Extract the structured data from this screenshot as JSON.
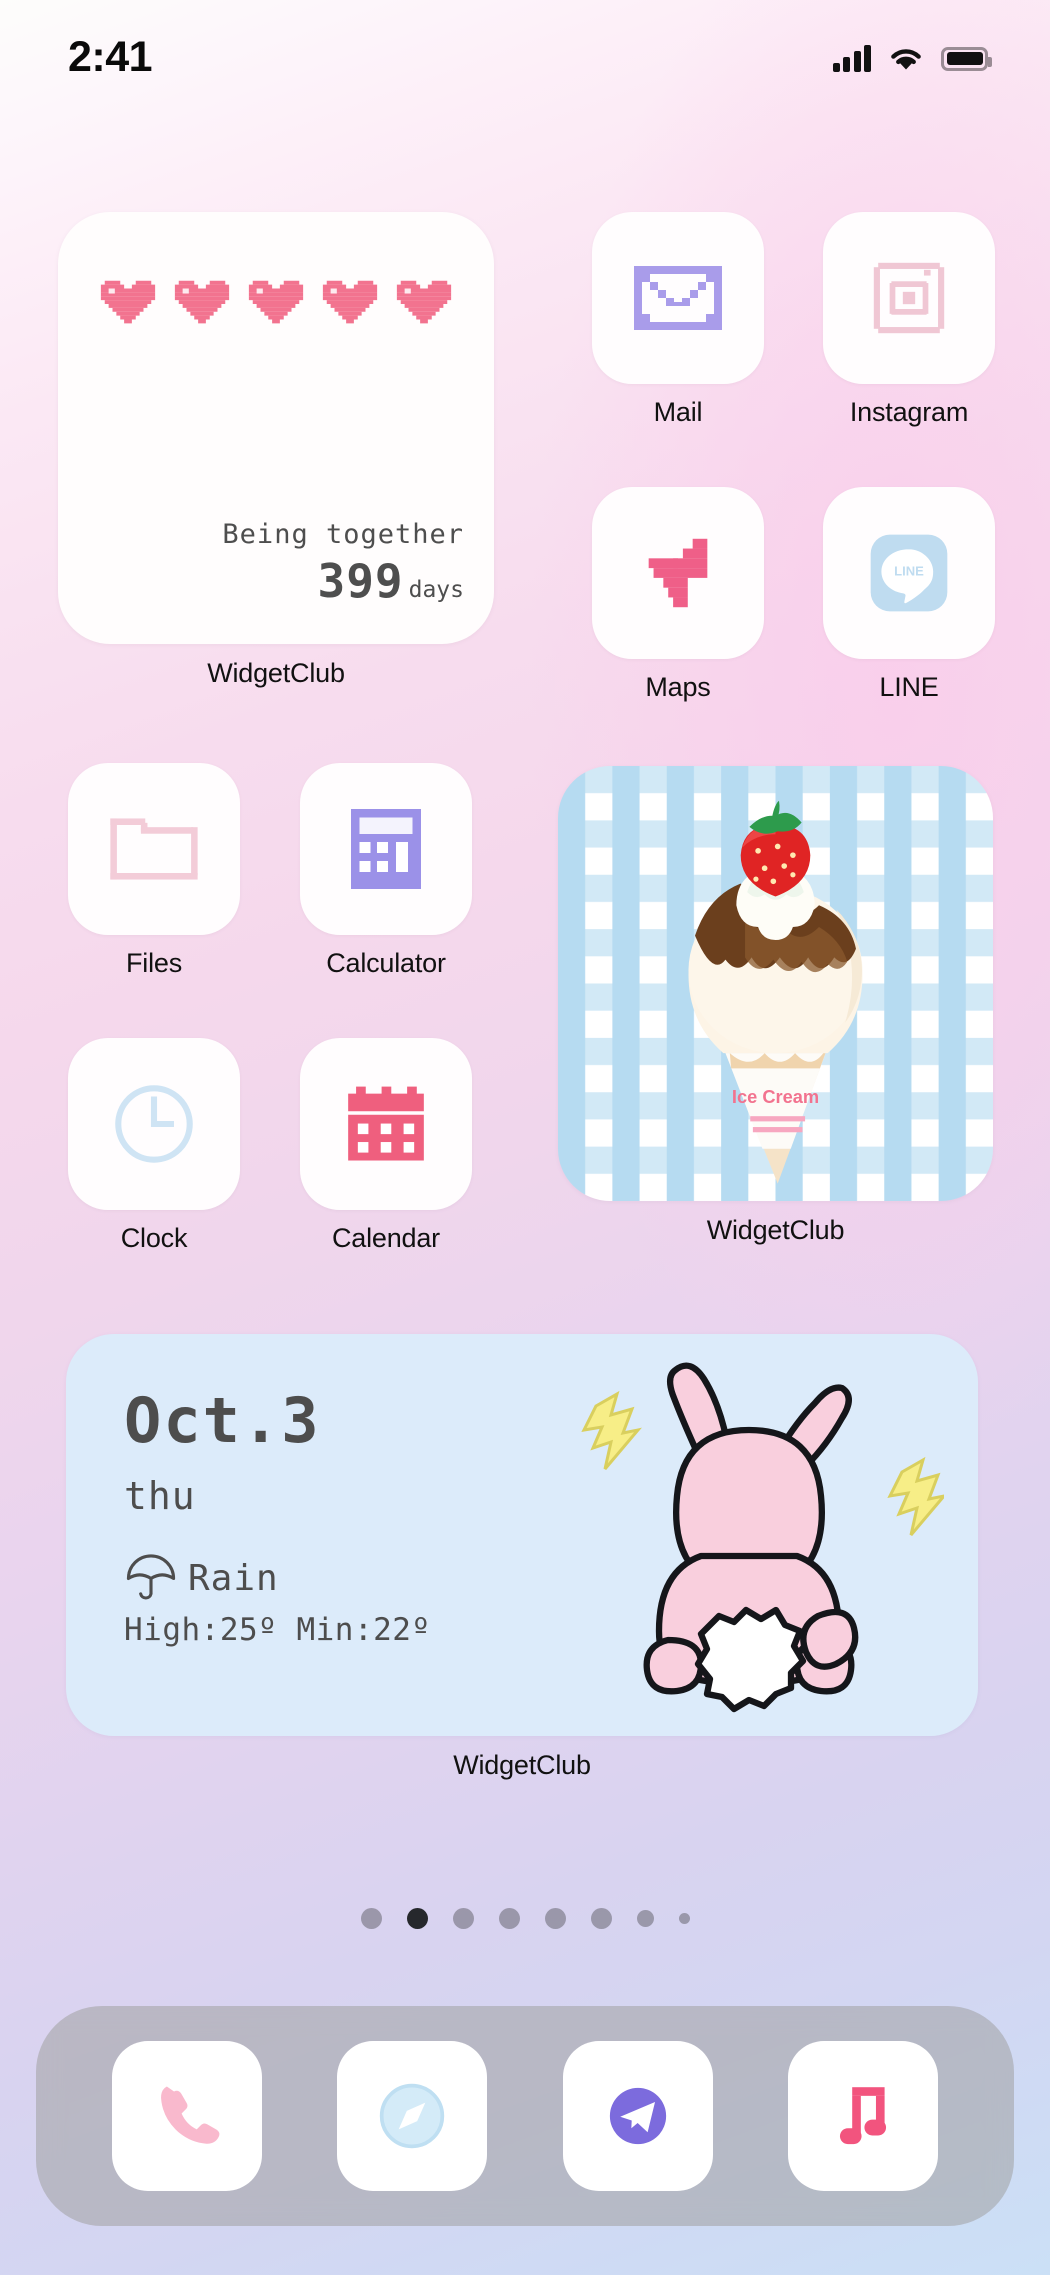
{
  "status_bar": {
    "time": "2:41",
    "signal_icon": "cellular-signal-icon",
    "wifi_icon": "wifi-icon",
    "battery_icon": "battery-full-icon"
  },
  "widgets": {
    "heart_counter": {
      "label": "WidgetClub",
      "caption": "Being together",
      "count": "399",
      "unit": "days",
      "hearts": 5,
      "heart_color": "#f2738f"
    },
    "ice_cream": {
      "label": "WidgetClub",
      "wrapper_text": "Ice Cream",
      "background_color": "#b8dcf2"
    },
    "weather": {
      "label": "WidgetClub",
      "date": "Oct.3",
      "weekday": "thu",
      "condition": "Rain",
      "condition_icon": "umbrella-icon",
      "temperature": "High:25º Min:22º",
      "background_color": "#dcebfa"
    }
  },
  "apps": [
    {
      "label": "Mail",
      "icon": "mail-envelope-icon",
      "color": "#a99cea"
    },
    {
      "label": "Instagram",
      "icon": "instagram-camera-icon",
      "color": "#f2cdd8"
    },
    {
      "label": "Maps",
      "icon": "maps-arrow-icon",
      "color": "#ef5f88"
    },
    {
      "label": "LINE",
      "icon": "line-chat-icon",
      "color": "#bcdcf0"
    },
    {
      "label": "Files",
      "icon": "folder-icon",
      "color": "#f5d5dd"
    },
    {
      "label": "Calculator",
      "icon": "calculator-icon",
      "color": "#9b91e8"
    },
    {
      "label": "Clock",
      "icon": "clock-icon",
      "color": "#cfe4f4"
    },
    {
      "label": "Calendar",
      "icon": "calendar-icon",
      "color": "#ef5f7e"
    }
  ],
  "page_indicator": {
    "total": 8,
    "active_index": 1
  },
  "dock": [
    {
      "icon": "phone-icon",
      "color": "#f9b9cd"
    },
    {
      "icon": "compass-icon",
      "color": "#c8e4f4"
    },
    {
      "icon": "telegram-icon",
      "color": "#7c6bdd"
    },
    {
      "icon": "music-note-icon",
      "color": "#f2547e"
    }
  ]
}
